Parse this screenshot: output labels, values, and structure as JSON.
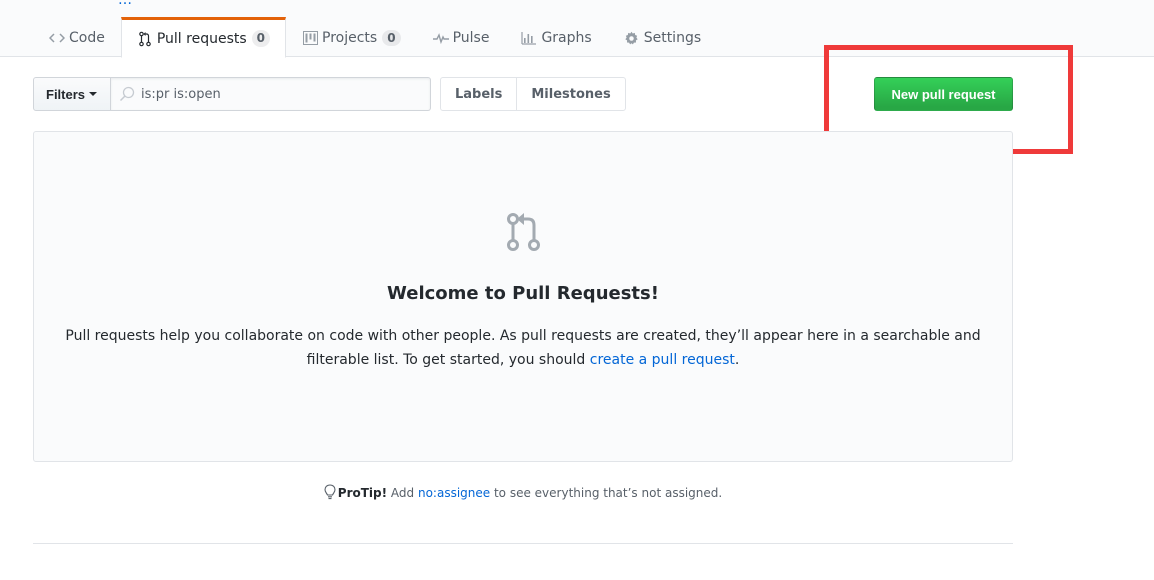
{
  "repo_header": {
    "truncated_title": "…",
    "tabs": [
      {
        "label": "Code",
        "icon": "code-icon",
        "counter": null,
        "selected": false
      },
      {
        "label": "Pull requests",
        "icon": "git-pull-request-icon",
        "counter": "0",
        "selected": true
      },
      {
        "label": "Projects",
        "icon": "project-icon",
        "counter": "0",
        "selected": false
      },
      {
        "label": "Pulse",
        "icon": "pulse-icon",
        "counter": null,
        "selected": false
      },
      {
        "label": "Graphs",
        "icon": "graph-icon",
        "counter": null,
        "selected": false
      },
      {
        "label": "Settings",
        "icon": "gear-icon",
        "counter": null,
        "selected": false
      }
    ]
  },
  "subnav": {
    "filters_label": "Filters",
    "search_value": "is:pr is:open",
    "labels_label": "Labels",
    "milestones_label": "Milestones",
    "new_pr_label": "New pull request"
  },
  "blankslate": {
    "title": "Welcome to Pull Requests!",
    "text_before_link": "Pull requests help you collaborate on code with other people. As pull requests are created, they’ll appear here in a searchable and filterable list. To get started, you should ",
    "link_text": "create a pull request",
    "text_after_link": "."
  },
  "protip": {
    "label": "ProTip!",
    "before": " Add ",
    "link": "no:assignee",
    "after": " to see everything that’s not assigned."
  },
  "colors": {
    "accent_tab": "#e36209",
    "primary_green": "#28a745",
    "link_blue": "#0366d6",
    "annotation_red": "#ef3a3a"
  }
}
